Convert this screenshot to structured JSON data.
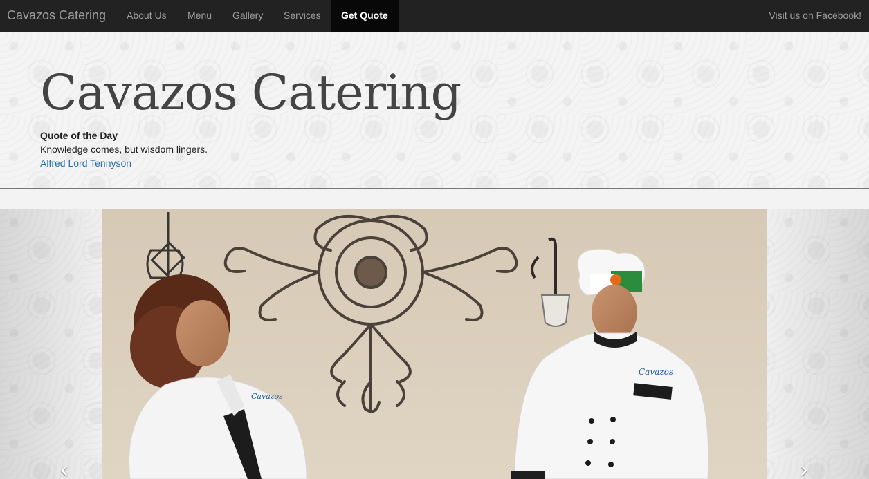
{
  "nav": {
    "brand": "Cavazos Catering",
    "items": [
      {
        "label": "About Us"
      },
      {
        "label": "Menu"
      },
      {
        "label": "Gallery"
      },
      {
        "label": "Services"
      },
      {
        "label": "Get Quote"
      }
    ],
    "facebook": "Visit us on Facebook!"
  },
  "header": {
    "title": "Cavazos Catering",
    "quote_heading": "Quote of the Day",
    "quote_text": "Knowledge comes, but wisdom lingers.",
    "quote_author": "Alfred Lord Tennyson"
  },
  "carousel": {
    "prev_icon": "chevron-left-icon",
    "next_icon": "chevron-right-icon",
    "prev_glyph": "‹",
    "next_glyph": "›"
  }
}
